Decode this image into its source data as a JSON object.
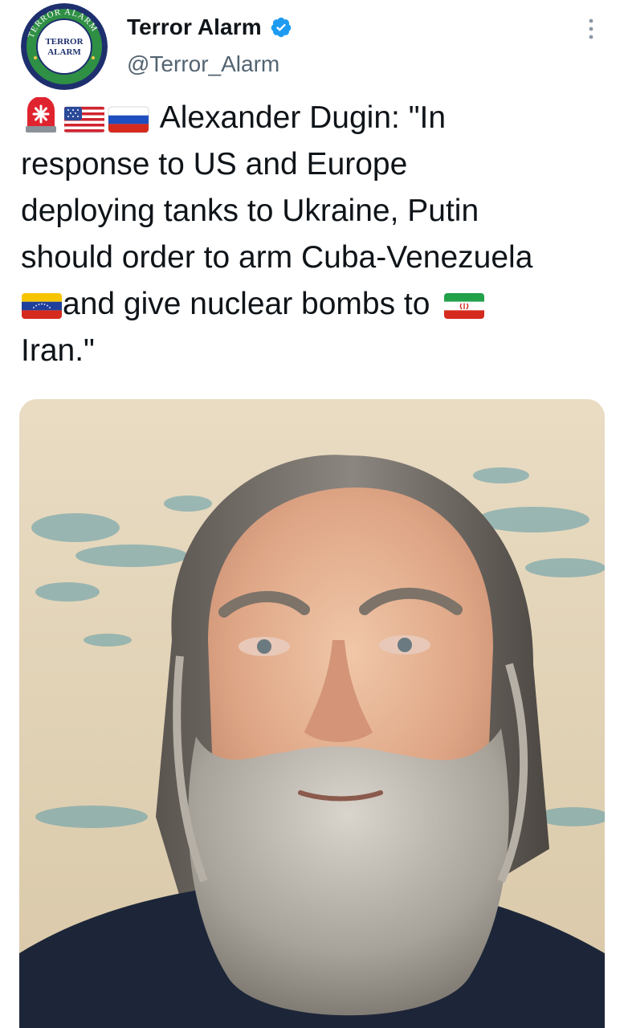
{
  "author": {
    "display_name": "Terror Alarm",
    "handle": "@Terror_Alarm",
    "avatar_text_line1": "TERROR",
    "avatar_text_line2": "ALARM",
    "avatar_ring_text": "TERROR ALARM",
    "verified": true
  },
  "tweet": {
    "lines": [
      "Alexander Dugin: \"In",
      "response to US and Europe",
      "deploying tanks to Ukraine, Putin",
      "should order to arm Cuba-Venezuela",
      "and give nuclear bombs to",
      "Iran.\""
    ],
    "emojis": [
      "police-light-emoji",
      "us-flag-emoji",
      "russia-flag-emoji",
      "venezuela-flag-emoji",
      "iran-flag-emoji"
    ]
  },
  "colors": {
    "accent": "#1d9bf0",
    "text": "#0f1419",
    "secondary": "#536471",
    "avatar_navy": "#1e2f6e",
    "avatar_green": "#2b8a3e"
  },
  "icons": {
    "verified": "verified-badge-icon",
    "more": "more-vertical-icon"
  }
}
